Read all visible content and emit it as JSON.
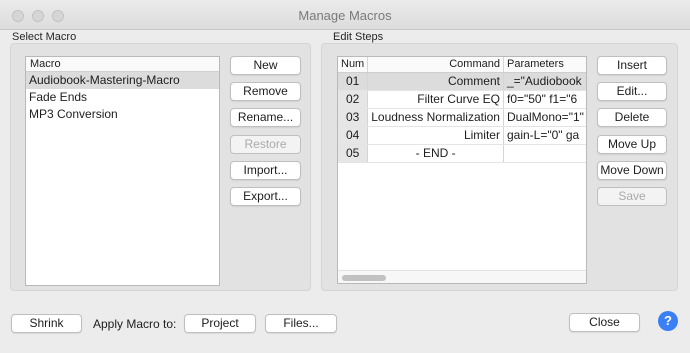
{
  "window": {
    "title": "Manage Macros"
  },
  "select_macro": {
    "label": "Select Macro",
    "column_header": "Macro",
    "items": [
      "Audiobook-Mastering-Macro",
      "Fade Ends",
      "MP3 Conversion"
    ],
    "buttons": {
      "new": "New",
      "remove": "Remove",
      "rename": "Rename...",
      "restore": "Restore",
      "import": "Import...",
      "export": "Export..."
    }
  },
  "edit_steps": {
    "label": "Edit Steps",
    "columns": [
      "Num",
      "Command",
      "Parameters"
    ],
    "rows": [
      {
        "num": "01",
        "command": "Comment",
        "params": "_=\"Audiobook"
      },
      {
        "num": "02",
        "command": "Filter Curve EQ",
        "params": "f0=\"50\" f1=\"6"
      },
      {
        "num": "03",
        "command": "Loudness Normalization",
        "params": "DualMono=\"1\""
      },
      {
        "num": "04",
        "command": "Limiter",
        "params": "gain-L=\"0\" ga"
      },
      {
        "num": "05",
        "command": "- END -",
        "params": ""
      }
    ],
    "buttons": {
      "insert": "Insert",
      "edit": "Edit...",
      "delete": "Delete",
      "move_up": "Move Up",
      "move_down": "Move Down",
      "save": "Save"
    }
  },
  "footer": {
    "shrink": "Shrink",
    "apply_label": "Apply Macro to:",
    "project": "Project",
    "files": "Files...",
    "close": "Close",
    "help": "?"
  },
  "colors": {
    "selection": "#dcdcdc",
    "help_blue": "#3b7ff5"
  }
}
